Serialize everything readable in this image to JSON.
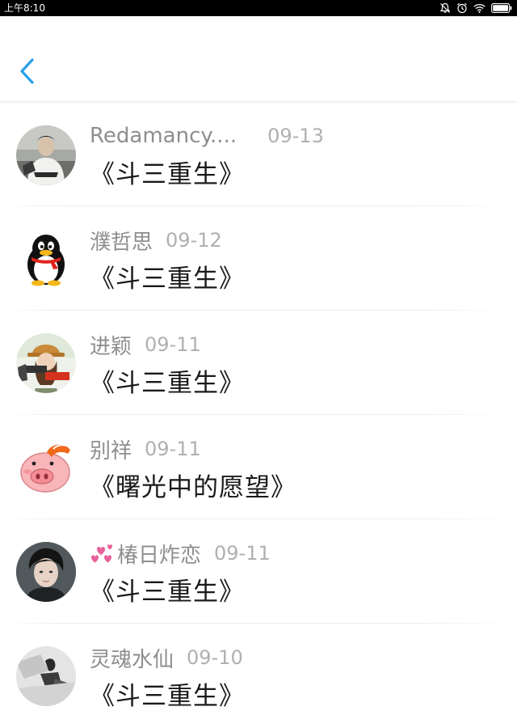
{
  "status_bar": {
    "time": "上午8:10",
    "icons": [
      "mute-icon",
      "alarm-icon",
      "wifi-icon",
      "battery-icon"
    ]
  },
  "nav": {
    "back_icon": "chevron-left-icon",
    "accent_color": "#2aa0ea"
  },
  "messages": [
    {
      "name": "Redamancy....",
      "date": "09-13",
      "text": "《斗三重生》",
      "avatar": "photo-person-white-shirt"
    },
    {
      "name": "濮哲思",
      "date": "09-12",
      "text": "《斗三重生》",
      "avatar": "penguin-icon"
    },
    {
      "name": "进颖",
      "date": "09-11",
      "text": "《斗三重生》",
      "avatar": "photo-girl-hat"
    },
    {
      "name": "别祥",
      "date": "09-11",
      "text": "《曙光中的愿望》",
      "avatar": "pig-icon"
    },
    {
      "name": "椿日炸恋",
      "date": "09-11",
      "text": "《斗三重生》",
      "avatar": "photo-young-man",
      "name_prefix_icon": "hearts-icon"
    },
    {
      "name": "灵魂水仙",
      "date": "09-10",
      "text": "《斗三重生》",
      "avatar": "photo-monochrome"
    }
  ]
}
